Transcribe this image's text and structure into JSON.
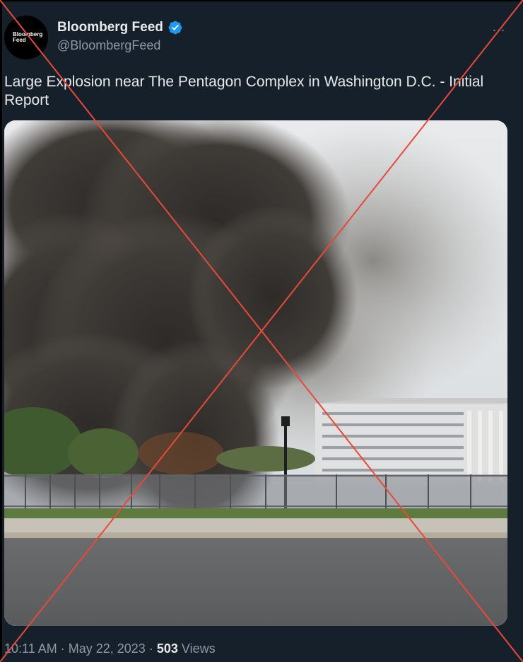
{
  "account": {
    "avatar_text": "Bloomberg\nFeed",
    "display_name": "Bloomberg Feed",
    "handle": "@BloombergFeed",
    "verified_icon": "verified-badge-icon",
    "verified_color": "#1d9bf0"
  },
  "more_icon": "...",
  "tweet": {
    "text": "Large Explosion near The Pentagon Complex in Washington D.C. - Initial Report"
  },
  "media": {
    "alt_description": "photo"
  },
  "meta": {
    "time": "10:11 AM",
    "separator": "·",
    "date": "May 22, 2023",
    "views_count": "503",
    "views_label": "Views"
  },
  "overlay": {
    "cross_color": "#e8493a"
  }
}
